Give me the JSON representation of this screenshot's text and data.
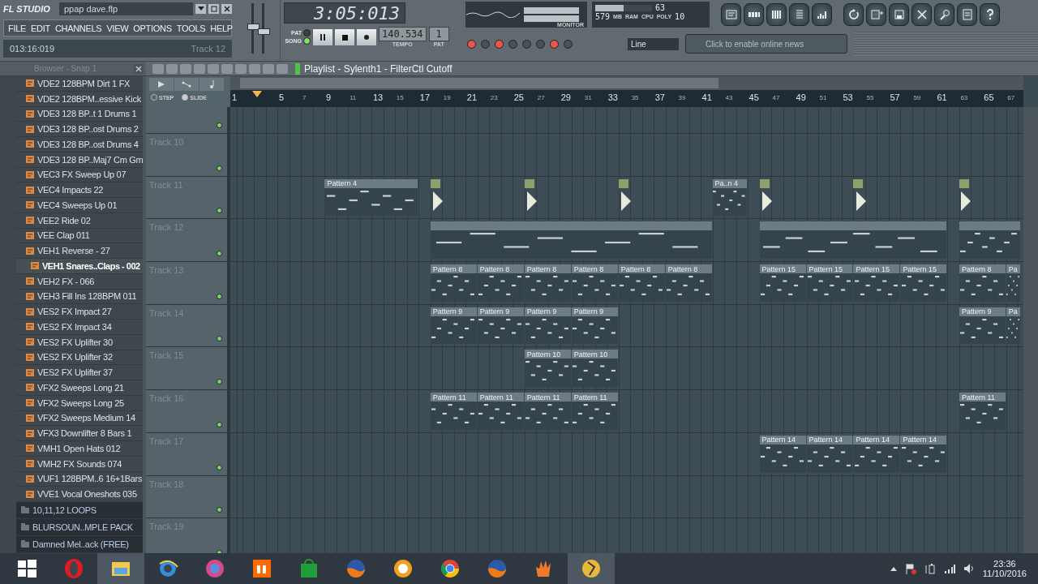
{
  "title": {
    "logo": "FL STUDIO",
    "file": "ppap dave.flp"
  },
  "menu": [
    "FILE",
    "EDIT",
    "CHANNELS",
    "VIEW",
    "OPTIONS",
    "TOOLS",
    "HELP"
  ],
  "hint": {
    "time": "013:16:019",
    "target": "Track 12"
  },
  "faders": [
    {
      "level": 0.55
    },
    {
      "level": 0.45
    }
  ],
  "transport": {
    "time": "3:05:013",
    "modes": [
      {
        "label": "PAT",
        "selected": false
      },
      {
        "label": "SONG",
        "selected": true
      }
    ],
    "tempo": "140.534",
    "tempo_label": "TEMPO",
    "pattern": "1",
    "pattern_label": "PAT"
  },
  "monitor": {
    "label": "MONITOR",
    "cpu": "63",
    "cpu_level": {
      "level": 0.5
    },
    "ram": "579",
    "ram_unit": "MB",
    "ram_label": "RAM",
    "cpu_label": "CPU",
    "poly_label": "POLY",
    "poly": "10"
  },
  "toggles": [
    {
      "on": true
    },
    {
      "on": false
    },
    {
      "on": true
    },
    {
      "on": false
    },
    {
      "on": false
    },
    {
      "on": false
    },
    {
      "on": true
    },
    {
      "on": false
    }
  ],
  "snap": {
    "value": "Line"
  },
  "news": {
    "placeholder": "Click to enable online news"
  },
  "browser": {
    "title": "Browser - Snap 1",
    "items": [
      {
        "kind": "file",
        "label": "VDE2 128BPM Dirt 1 FX",
        "selected": false
      },
      {
        "kind": "file",
        "label": "VDE2 128BPM..essive Kick",
        "selected": false
      },
      {
        "kind": "file",
        "label": "VDE3 128 BP..t 1 Drums 1",
        "selected": false
      },
      {
        "kind": "file",
        "label": "VDE3 128 BP..ost Drums 2",
        "selected": false
      },
      {
        "kind": "file",
        "label": "VDE3 128 BP..ost Drums 4",
        "selected": false
      },
      {
        "kind": "file",
        "label": "VDE3 128 BP..Maj7 Cm Gm",
        "selected": false
      },
      {
        "kind": "file",
        "label": "VEC3 FX Sweep Up 07",
        "selected": false
      },
      {
        "kind": "file",
        "label": "VEC4 Impacts 22",
        "selected": false
      },
      {
        "kind": "file",
        "label": "VEC4 Sweeps Up 01",
        "selected": false
      },
      {
        "kind": "file",
        "label": "VEE2 Ride 02",
        "selected": false
      },
      {
        "kind": "file",
        "label": "VEE Clap 011",
        "selected": false
      },
      {
        "kind": "file",
        "label": "VEH1 Reverse - 27",
        "selected": false
      },
      {
        "kind": "file",
        "label": "VEH1 Snares..Claps - 002",
        "selected": true
      },
      {
        "kind": "file",
        "label": "VEH2 FX - 066",
        "selected": false
      },
      {
        "kind": "file",
        "label": "VEH3 Fill Ins 128BPM 011",
        "selected": false
      },
      {
        "kind": "file",
        "label": "VES2 FX Impact 27",
        "selected": false
      },
      {
        "kind": "file",
        "label": "VES2 FX Impact 34",
        "selected": false
      },
      {
        "kind": "file",
        "label": "VES2 FX Uplifter 30",
        "selected": false
      },
      {
        "kind": "file",
        "label": "VES2 FX Uplifter 32",
        "selected": false
      },
      {
        "kind": "file",
        "label": "VES2 FX Uplifter 37",
        "selected": false
      },
      {
        "kind": "file",
        "label": "VFX2 Sweeps Long 21",
        "selected": false
      },
      {
        "kind": "file",
        "label": "VFX2 Sweeps Long 25",
        "selected": false
      },
      {
        "kind": "file",
        "label": "VFX2 Sweeps Medium 14",
        "selected": false
      },
      {
        "kind": "file",
        "label": "VFX3 Downlifter 8 Bars 1",
        "selected": false
      },
      {
        "kind": "file",
        "label": "VMH1 Open Hats 012",
        "selected": false
      },
      {
        "kind": "file",
        "label": "VMH2 FX Sounds 074",
        "selected": false
      },
      {
        "kind": "file",
        "label": "VUF1 128BPM..6 16+1Bars",
        "selected": false
      },
      {
        "kind": "file",
        "label": "VVE1 Vocal Oneshots 035",
        "selected": false
      },
      {
        "kind": "folder",
        "label": "10,11,12 LOOPS",
        "selected": false
      },
      {
        "kind": "folder",
        "label": "BLURSOUN..MPLE PACK",
        "selected": false
      },
      {
        "kind": "folder",
        "label": "Damned Mel..ack (FREE)",
        "selected": false
      }
    ]
  },
  "playlist": {
    "title": "Playlist - Sylenth1 - FilterCtl Cutoff",
    "modes": [
      {
        "label": "STEP",
        "selected": false
      },
      {
        "label": "SLIDE",
        "selected": true
      }
    ],
    "ruler": [
      {
        "label": "1",
        "major": true
      },
      {
        "label": "5",
        "major": true
      },
      {
        "label": "7",
        "major": false
      },
      {
        "label": "9",
        "major": true
      },
      {
        "label": "11",
        "major": false
      },
      {
        "label": "13",
        "major": true
      },
      {
        "label": "15",
        "major": false
      },
      {
        "label": "17",
        "major": true
      },
      {
        "label": "19",
        "major": false
      },
      {
        "label": "21",
        "major": true
      },
      {
        "label": "23",
        "major": false
      },
      {
        "label": "25",
        "major": true
      },
      {
        "label": "27",
        "major": false
      },
      {
        "label": "29",
        "major": true
      },
      {
        "label": "31",
        "major": false
      },
      {
        "label": "33",
        "major": true
      },
      {
        "label": "35",
        "major": false
      },
      {
        "label": "37",
        "major": true
      },
      {
        "label": "39",
        "major": false
      },
      {
        "label": "41",
        "major": true
      },
      {
        "label": "43",
        "major": false
      },
      {
        "label": "45",
        "major": true
      },
      {
        "label": "47",
        "major": false
      },
      {
        "label": "49",
        "major": true
      },
      {
        "label": "51",
        "major": false
      },
      {
        "label": "53",
        "major": true
      },
      {
        "label": "55",
        "major": false
      },
      {
        "label": "57",
        "major": true
      },
      {
        "label": "59",
        "major": false
      },
      {
        "label": "61",
        "major": true
      },
      {
        "label": "63",
        "major": false
      },
      {
        "label": "65",
        "major": true
      },
      {
        "label": "67",
        "major": false
      }
    ],
    "tracks": [
      {
        "name": "Track 10"
      },
      {
        "name": "Track 11",
        "clips": [
          {
            "kind": "pattern",
            "label": "Pattern 4"
          },
          {
            "kind": "automation"
          },
          {
            "kind": "automation"
          },
          {
            "kind": "automation"
          },
          {
            "kind": "pattern",
            "label": "Pa..n 4"
          },
          {
            "kind": "automation"
          },
          {
            "kind": "automation"
          },
          {
            "kind": "automation"
          }
        ]
      },
      {
        "name": "Track 12",
        "clips": [
          {
            "kind": "pattern"
          },
          {
            "kind": "pattern"
          },
          {
            "kind": "pattern"
          }
        ]
      },
      {
        "name": "Track 13",
        "clips": [
          {
            "kind": "pattern",
            "label": "Pattern 8"
          },
          {
            "kind": "pattern",
            "label": "Pattern 8"
          },
          {
            "kind": "pattern",
            "label": "Pattern 8"
          },
          {
            "kind": "pattern",
            "label": "Pattern 8"
          },
          {
            "kind": "pattern",
            "label": "Pattern 8"
          },
          {
            "kind": "pattern",
            "label": "Pattern 8"
          },
          {
            "kind": "pattern",
            "label": "Pattern 15"
          },
          {
            "kind": "pattern",
            "label": "Pattern 15"
          },
          {
            "kind": "pattern",
            "label": "Pattern 15"
          },
          {
            "kind": "pattern",
            "label": "Pattern 15"
          },
          {
            "kind": "pattern",
            "label": "Pattern 8"
          },
          {
            "kind": "pattern",
            "label": "Pa"
          }
        ]
      },
      {
        "name": "Track 14",
        "clips": [
          {
            "kind": "pattern",
            "label": "Pattern 9"
          },
          {
            "kind": "pattern",
            "label": "Pattern 9"
          },
          {
            "kind": "pattern",
            "label": "Pattern 9"
          },
          {
            "kind": "pattern",
            "label": "Pattern 9"
          },
          {
            "kind": "pattern",
            "label": "Pattern 9"
          },
          {
            "kind": "pattern",
            "label": "Pa"
          }
        ]
      },
      {
        "name": "Track 15",
        "clips": [
          {
            "kind": "pattern",
            "label": "Pattern 10"
          },
          {
            "kind": "pattern",
            "label": "Pattern 10"
          }
        ]
      },
      {
        "name": "Track 16",
        "clips": [
          {
            "kind": "pattern",
            "label": "Pattern 11"
          },
          {
            "kind": "pattern",
            "label": "Pattern 11"
          },
          {
            "kind": "pattern",
            "label": "Pattern 11"
          },
          {
            "kind": "pattern",
            "label": "Pattern 11"
          },
          {
            "kind": "pattern",
            "label": "Pattern 11"
          }
        ]
      },
      {
        "name": "Track 17",
        "clips": [
          {
            "kind": "pattern",
            "label": "Pattern 14"
          },
          {
            "kind": "pattern",
            "label": "Pattern 14"
          },
          {
            "kind": "pattern",
            "label": "Pattern 14"
          },
          {
            "kind": "pattern",
            "label": "Pattern 14"
          }
        ]
      },
      {
        "name": "Track 18"
      },
      {
        "name": "Track 19"
      }
    ]
  },
  "taskbar": {
    "apps": [
      {
        "selected": false
      },
      {
        "selected": false
      },
      {
        "selected": true
      },
      {
        "selected": false
      },
      {
        "selected": false
      },
      {
        "selected": false
      },
      {
        "selected": false
      },
      {
        "selected": false
      },
      {
        "selected": false
      },
      {
        "selected": false
      },
      {
        "selected": false
      },
      {
        "selected": false
      },
      {
        "selected": true
      }
    ],
    "time": "23:36",
    "date": "11/10/2016"
  }
}
